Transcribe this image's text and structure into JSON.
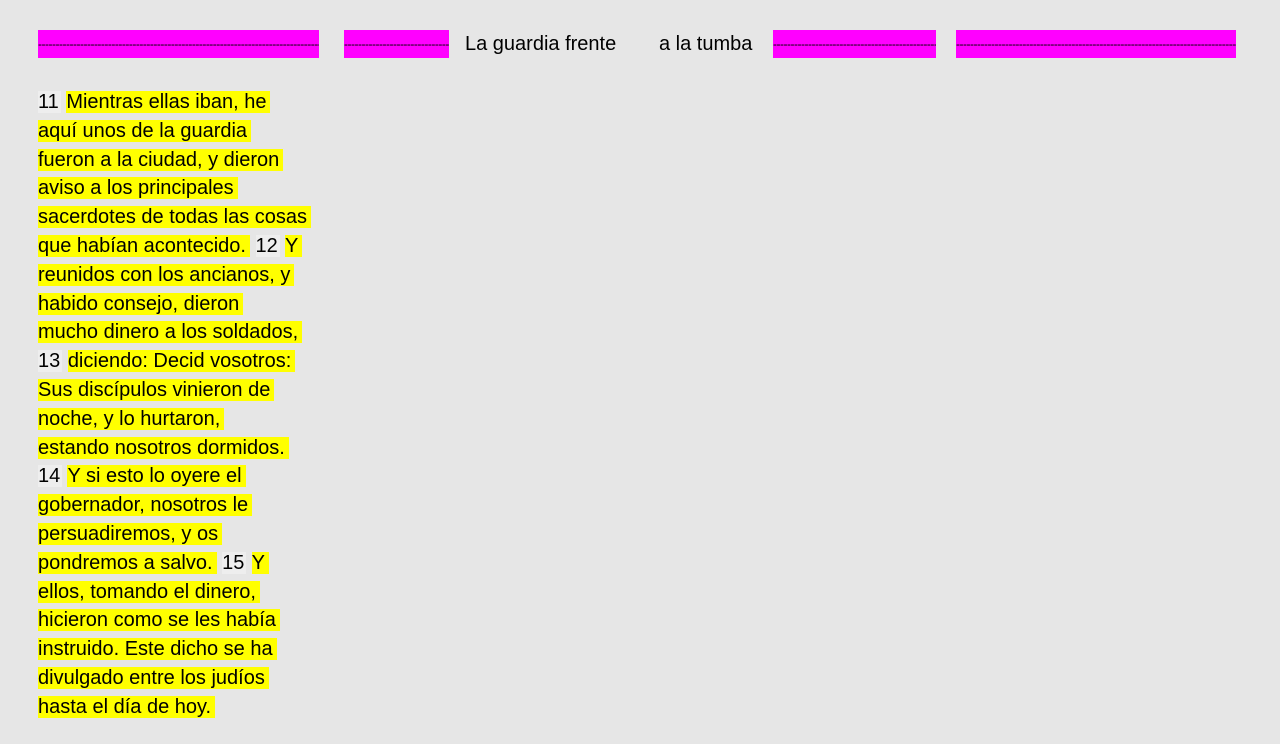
{
  "title": {
    "dashes": [
      "------------------------------------------------------------------------------------",
      "------------------------------",
      "------------------------------------------------",
      "----------------------------------------------------------------------------------"
    ],
    "part_a": "La guardia frente",
    "part_b": "a la tumba"
  },
  "passage": {
    "line1_num": "11",
    "line1": "Mientras ellas iban, he",
    "line2": "aquí unos de la guardia",
    "line3": "fueron a la ciudad, y dieron",
    "line4": "aviso a los principales",
    "line5": "sacerdotes de todas las cosas",
    "line6": "que habían acontecido.",
    "line6_num": "12",
    "line6_tail": "Y",
    "line7": "reunidos con los ancianos, y",
    "line8": "habido consejo, dieron",
    "line9": "mucho dinero a los soldados,",
    "line10_num": "13",
    "line10": "diciendo: Decid vosotros:",
    "line11": "Sus discípulos vinieron de",
    "line12": "noche, y lo hurtaron,",
    "line13": "estando nosotros dormidos.",
    "line14_num": "14",
    "line14": "Y si esto lo oyere el",
    "line15": "gobernador, nosotros le",
    "line16": "persuadiremos, y os",
    "line17": "pondremos a salvo.",
    "line17_num": "15",
    "line17_tail": "Y",
    "line18": "ellos, tomando el dinero,",
    "line19": "hicieron como se les había",
    "line20": "instruido. Este dicho se ha",
    "line21": "divulgado entre los judíos",
    "line22": "hasta el día de hoy."
  },
  "colors": {
    "background": "#e6e6e6",
    "dash_highlight": "#ff00ff",
    "text_highlight": "#ffff00"
  }
}
